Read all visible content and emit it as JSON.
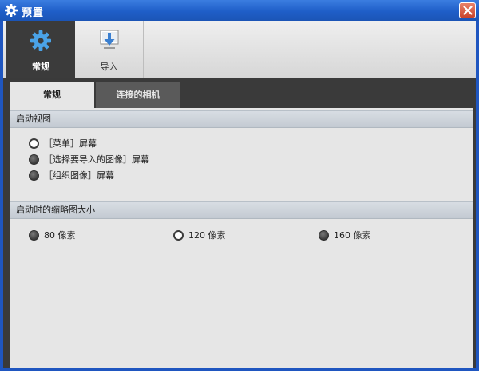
{
  "window": {
    "title": "预置",
    "icon": "gear-icon",
    "close_icon": "close-icon"
  },
  "toolbar": {
    "items": [
      {
        "label": "常规",
        "icon": "gear-icon",
        "active": true
      },
      {
        "label": "导入",
        "icon": "import-arrow-icon",
        "active": false
      }
    ]
  },
  "tabs": [
    {
      "label": "常规",
      "active": true
    },
    {
      "label": "连接的相机",
      "active": false
    }
  ],
  "startup_view": {
    "header": "启动视图",
    "options": [
      {
        "label": "［菜单］屏幕",
        "selected": true
      },
      {
        "label": "［选择要导入的图像］屏幕",
        "selected": false
      },
      {
        "label": "［组织图像］屏幕",
        "selected": false
      }
    ]
  },
  "thumbnail_size": {
    "header": "启动时的缩略图大小",
    "options": [
      {
        "label": "80 像素",
        "selected": false
      },
      {
        "label": "120 像素",
        "selected": true
      },
      {
        "label": "160 像素",
        "selected": false
      }
    ]
  },
  "colors": {
    "titlebar": "#1f5ec8",
    "toolbar_active": "#3b3b3b",
    "section_header": "#c8cfd6",
    "panel": "#e6e6e6"
  }
}
